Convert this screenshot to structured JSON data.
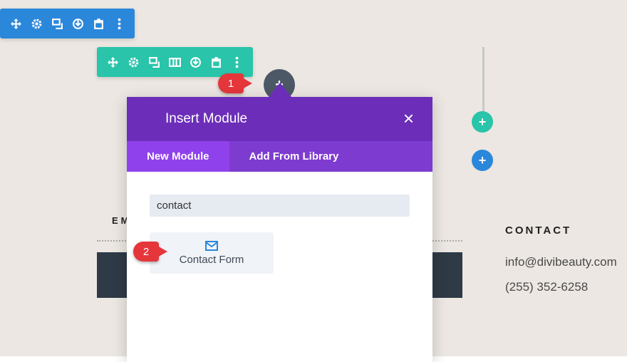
{
  "row_toolbar": {
    "icons": [
      "move-icon",
      "gear-icon",
      "duplicate-icon",
      "save-icon",
      "trash-icon",
      "more-icon"
    ]
  },
  "section_toolbar": {
    "icons": [
      "move-icon",
      "gear-icon",
      "duplicate-icon",
      "columns-icon",
      "save-icon",
      "trash-icon",
      "more-icon"
    ]
  },
  "callouts": {
    "one": "1",
    "two": "2"
  },
  "modal": {
    "title": "Insert Module",
    "tabs": [
      "New Module",
      "Add From Library"
    ],
    "search_value": "contact",
    "module": "Contact Form"
  },
  "page": {
    "em_label": "EM",
    "contact_heading": "CONTACT",
    "email": "info@divibeauty.com",
    "phone": "(255) 352-6258"
  },
  "colors": {
    "row": "#2b87da",
    "section": "#29c4a9",
    "modal": "#6c2eb9"
  }
}
